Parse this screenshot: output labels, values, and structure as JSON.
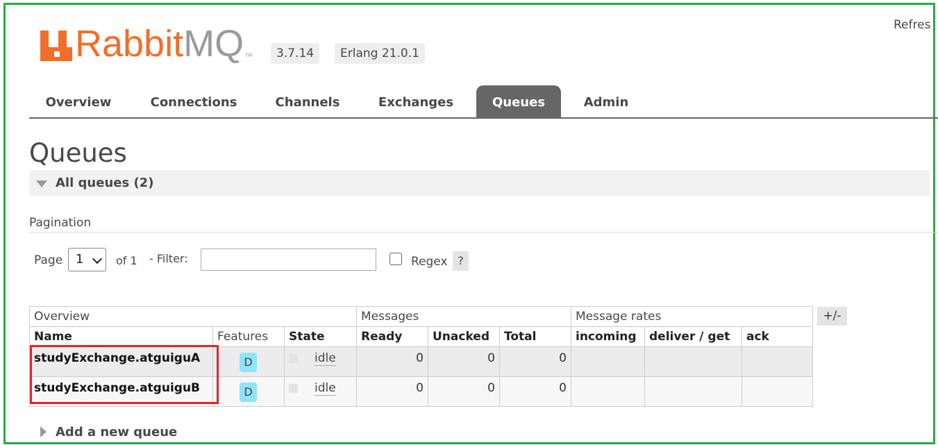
{
  "header": {
    "brand_rabbit": "Rabbit",
    "brand_mq": "MQ",
    "brand_tm": "TM",
    "version": "3.7.14",
    "erlang": "Erlang 21.0.1",
    "refresh": "Refres"
  },
  "tabs": [
    {
      "label": "Overview"
    },
    {
      "label": "Connections"
    },
    {
      "label": "Channels"
    },
    {
      "label": "Exchanges"
    },
    {
      "label": "Queues",
      "active": true
    },
    {
      "label": "Admin"
    }
  ],
  "page": {
    "title": "Queues",
    "section": "All queues (2)"
  },
  "pagination": {
    "label": "Pagination",
    "page_label": "Page",
    "page_value": "1",
    "of_label": "of 1",
    "filter_label": "- Filter:",
    "filter_value": "",
    "regex_label": "Regex",
    "help": "?"
  },
  "table": {
    "groups": [
      "Overview",
      "Messages",
      "Message rates"
    ],
    "columns": [
      "Name",
      "Features",
      "State",
      "Ready",
      "Unacked",
      "Total",
      "incoming",
      "deliver / get",
      "ack"
    ],
    "rows": [
      {
        "name": "studyExchange.atguiguA",
        "feature": "D",
        "state": "idle",
        "ready": "0",
        "unacked": "0",
        "total": "0"
      },
      {
        "name": "studyExchange.atguiguB",
        "feature": "D",
        "state": "idle",
        "ready": "0",
        "unacked": "0",
        "total": "0"
      }
    ],
    "toggle_columns": "+/-"
  },
  "footer": {
    "add_queue": "Add a new queue"
  },
  "colors": {
    "brand_orange": "#f36d2a",
    "tab_active": "#666666",
    "feature_badge": "#91e3f7",
    "highlight_red": "#e3242b",
    "frame_green": "#2aa84a"
  }
}
